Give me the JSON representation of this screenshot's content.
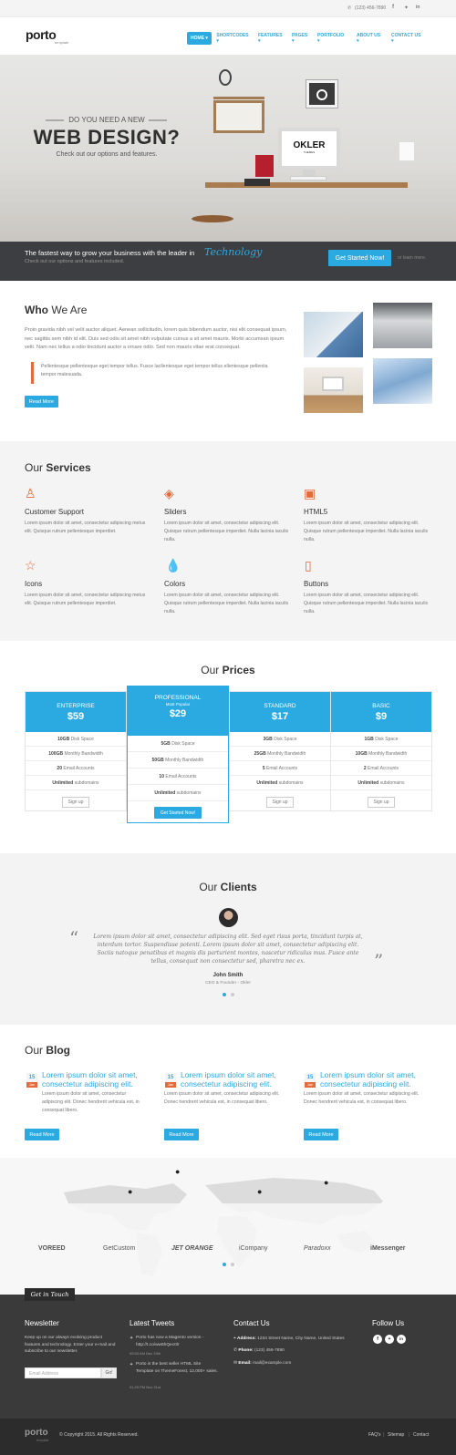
{
  "topbar": {
    "phone": "(123) 456-7890",
    "social": [
      "f-icon",
      "twitter-icon",
      "linkedin-icon"
    ]
  },
  "header": {
    "logo": "porto",
    "logo_sub": "template",
    "nav": [
      {
        "label": "HOME ▾"
      },
      {
        "label": "SHORTCODES ▾"
      },
      {
        "label": "FEATURES ▾"
      },
      {
        "label": "PAGES ▾"
      },
      {
        "label": "PORTFOLIO ▾"
      },
      {
        "label": "ABOUT US ▾"
      },
      {
        "label": "CONTACT US ▾"
      }
    ]
  },
  "hero": {
    "kicker": "DO YOU NEED A NEW",
    "title": "WEB DESIGN?",
    "subtitle": "Check out our options and features.",
    "monitor_text": "OKLER",
    "monitor_sub": "THEMES"
  },
  "banner": {
    "headline": "The fastest way to grow your business with the leader in",
    "highlight": "Technology",
    "subline": "Check out our options and features included.",
    "cta": "Get Started Now!",
    "learn_more": "or learn more."
  },
  "who": {
    "title_light": "Who",
    "title_bold": " We Are",
    "body": "Proin gravida nibh vel velit auctor aliquet. Aenean sollicitudin, lorem quis bibendum auctor, nisi elit consequat ipsum, nec sagittis sem nibh id elit. Duis sed odio sit amet nibh vulputate cursus a sit amet mauris. Morbi accumsan ipsum velit. Nam nec tellus a odio tincidunt auctor a ornare odio. Sed non mauris vitae erat consequat.",
    "quote": "Pellentesque pellentesque eget tempor tellus. Fusce lacllentesque eget tempor tellus ellentesque pelleniia tempor malesuada.",
    "button": "Read More"
  },
  "services": {
    "title_light": "Our",
    "title_bold": " Services",
    "items": [
      {
        "icon": "user-icon",
        "title": "Customer Support",
        "text": "Lorem ipsum dolor sit amet, consectetur adipiscing metus elit. Quisque rutrum pellentesque imperdiet."
      },
      {
        "icon": "layers-icon",
        "title": "Sliders",
        "text": "Lorem ipsum dolor sit amet, consectetur adipiscing elit. Quisque rutrum pellentesque imperdiet. Nulla lacinia iaculis nulla."
      },
      {
        "icon": "html5-icon",
        "title": "HTML5",
        "text": "Lorem ipsum dolor sit amet, consectetur adipiscing elit. Quisque rutrum pellentesque imperdiet. Nulla lacinia iaculis nulla."
      },
      {
        "icon": "star-icon",
        "title": "Icons",
        "text": "Lorem ipsum dolor sit amet, consectetur adipiscing metus elit. Quisque rutrum pellentesque imperdiet."
      },
      {
        "icon": "drop-icon",
        "title": "Colors",
        "text": "Lorem ipsum dolor sit amet, consectetur adipiscing elit. Quisque rutrum pellentesque imperdiet. Nulla lacinia iaculis nulla."
      },
      {
        "icon": "mouse-icon",
        "title": "Buttons",
        "text": "Lorem ipsum dolor sit amet, consectetur adipiscing elit. Quisque rutrum pellentesque imperdiet. Nulla lacinia iaculis nulla."
      }
    ]
  },
  "prices": {
    "title_light": "Our",
    "title_bold": " Prices",
    "plans": [
      {
        "name": "ENTERPRISE",
        "price": "$59",
        "rows": [
          [
            "10GB",
            "Disk Space"
          ],
          [
            "100GB",
            "Monthly Bandwidth"
          ],
          [
            "20",
            "Email Accounts"
          ],
          [
            "Unlimited",
            "subdomains"
          ]
        ],
        "button": "Sign up"
      },
      {
        "name": "PROFESSIONAL",
        "tag": "Most Popular",
        "price": "$29",
        "rows": [
          [
            "5GB",
            "Disk Space"
          ],
          [
            "50GB",
            "Monthly Bandwidth"
          ],
          [
            "10",
            "Email Accounts"
          ],
          [
            "Unlimited",
            "subdomains"
          ]
        ],
        "button": "Get Started Now!"
      },
      {
        "name": "STANDARD",
        "price": "$17",
        "rows": [
          [
            "3GB",
            "Disk Space"
          ],
          [
            "25GB",
            "Monthly Bandwidth"
          ],
          [
            "5",
            "Email Accounts"
          ],
          [
            "Unlimited",
            "subdomains"
          ]
        ],
        "button": "Sign up"
      },
      {
        "name": "BASIC",
        "price": "$9",
        "rows": [
          [
            "1GB",
            "Disk Space"
          ],
          [
            "10GB",
            "Monthly Bandwidth"
          ],
          [
            "2",
            "Email Accounts"
          ],
          [
            "Unlimited",
            "subdomains"
          ]
        ],
        "button": "Sign up"
      }
    ]
  },
  "clients": {
    "title_light": "Our",
    "title_bold": " Clients",
    "quote": "Lorem ipsum dolor sit amet, consectetur adipiscing elit. Sed eget risus porta, tincidunt turpis at, interdum tortor. Suspendisse potenti. Lorem ipsum dolor sit amet, consectetur adipiscing elit. Sociis natoque penatibus et magnis dis parturient montes, nascetur ridiculus mus. Fusce ante tellus, consequat non consectetur sed, pharetra nec ex.",
    "name": "John Smith",
    "role": "CEO & Founder - Okler"
  },
  "blog": {
    "title_light": "Our",
    "title_bold": " Blog",
    "posts": [
      {
        "day": "15",
        "month": "Jan",
        "title": "Lorem ipsum dolor sit amet, consectetur adipiscing elit.",
        "text": "Lorem ipsum dolor sit amet, consectetur adipiscing elit. Donec hendrerit vehicula est, in consequat libero.",
        "button": "Read More"
      },
      {
        "day": "15",
        "month": "Jan",
        "title": "Lorem ipsum dolor sit amet, consectetur adipiscing elit.",
        "text": "Lorem ipsum dolor sit amet, consectetur adipiscing elit. Donec hendrerit vehicula est, in consequat libero.",
        "button": "Read More"
      },
      {
        "day": "15",
        "month": "Jan",
        "title": "Lorem ipsum dolor sit amet, consectetur adipiscing elit.",
        "text": "Lorem ipsum dolor sit amet, consectetur adipiscing elit. Donec hendrerit vehicula est, in consequat libero.",
        "button": "Read More"
      }
    ]
  },
  "brands": [
    "VOREED",
    "GetCustom",
    "JET ORANGE",
    "iCompany",
    "Paradoxx",
    "iMessenger"
  ],
  "footer": {
    "tab": "Get in Touch",
    "newsletter": {
      "title": "Newsletter",
      "text": "Keep up on our always evolving product features and technology. Enter your e-mail and subscribe to our newsletter.",
      "placeholder": "Email Address",
      "go": "Go!"
    },
    "tweets": {
      "title": "Latest Tweets",
      "items": [
        {
          "text": "Porto has now a Magento version - http://t.co/ww6hQec0lr",
          "time": "09:53 AM Dec 19th"
        },
        {
          "text": "Porto is the best seller HTML Site Template on ThemeForest, 12,000+ sales.",
          "time": "01:25 PM Nov 21st"
        }
      ]
    },
    "contact": {
      "title": "Contact Us",
      "address_label": "Address:",
      "address": "1234 Street Name, City Name, United States",
      "phone_label": "Phone:",
      "phone": "(123) 456-7890",
      "email_label": "Email:",
      "email": "mail@example.com"
    },
    "follow": {
      "title": "Follow Us"
    },
    "copyright": "© Copyright 2015. All Rights Reserved.",
    "links": [
      "FAQ's",
      "Sitemap",
      "Contact"
    ],
    "logo": "porto",
    "logo_sub": "template"
  },
  "colors": {
    "accent": "#2baae1",
    "secondary": "#e36b3a",
    "dark": "#3a3a3a"
  }
}
